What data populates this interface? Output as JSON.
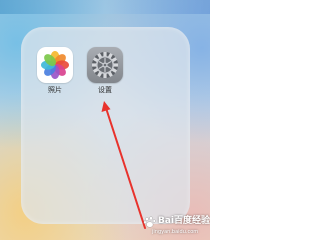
{
  "folder": {
    "apps": [
      {
        "label": "照片",
        "icon": "photos-icon"
      },
      {
        "label": "设置",
        "icon": "settings-gear-icon"
      }
    ]
  },
  "annotation": {
    "arrow_color": "#e8322c",
    "points_to": "settings-app"
  },
  "watermark": {
    "title": "Bai百度经验",
    "url": "jingyan.baidu.com"
  }
}
